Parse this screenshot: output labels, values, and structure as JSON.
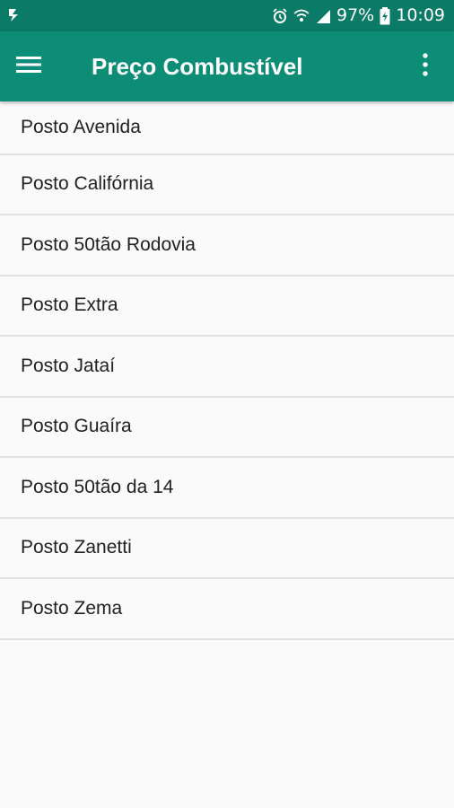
{
  "status_bar": {
    "battery": "97%",
    "time": "10:09",
    "icons": [
      "notification-icon",
      "alarm-icon",
      "wifi-icon",
      "signal-icon",
      "battery-icon"
    ]
  },
  "app_bar": {
    "title": "Preço Combustível",
    "menu_icon": "hamburger-menu-icon",
    "overflow_icon": "more-vert-icon"
  },
  "colors": {
    "status_bar": "#0b7a66",
    "app_bar": "#0d8c76",
    "background": "#fafafa",
    "divider": "#e2e2e2",
    "text": "#212121"
  },
  "stations": [
    {
      "label": "Posto Avenida"
    },
    {
      "label": "Posto Califórnia"
    },
    {
      "label": "Posto 50tão Rodovia"
    },
    {
      "label": "Posto Extra"
    },
    {
      "label": "Posto Jataí"
    },
    {
      "label": "Posto Guaíra"
    },
    {
      "label": "Posto 50tão da 14"
    },
    {
      "label": "Posto Zanetti"
    },
    {
      "label": "Posto Zema"
    }
  ]
}
